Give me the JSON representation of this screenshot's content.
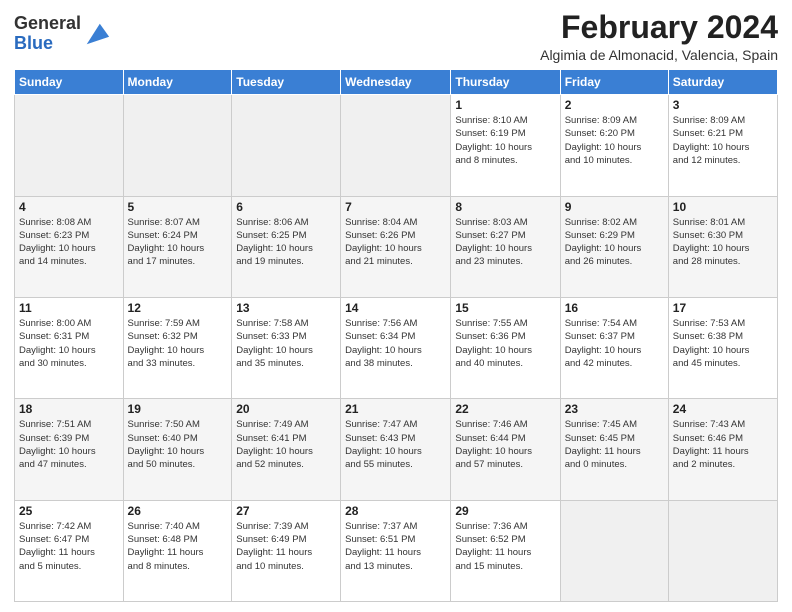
{
  "header": {
    "monthYear": "February 2024",
    "location": "Algimia de Almonacid, Valencia, Spain"
  },
  "columns": [
    "Sunday",
    "Monday",
    "Tuesday",
    "Wednesday",
    "Thursday",
    "Friday",
    "Saturday"
  ],
  "weeks": [
    [
      {
        "day": "",
        "info": ""
      },
      {
        "day": "",
        "info": ""
      },
      {
        "day": "",
        "info": ""
      },
      {
        "day": "",
        "info": ""
      },
      {
        "day": "1",
        "info": "Sunrise: 8:10 AM\nSunset: 6:19 PM\nDaylight: 10 hours\nand 8 minutes."
      },
      {
        "day": "2",
        "info": "Sunrise: 8:09 AM\nSunset: 6:20 PM\nDaylight: 10 hours\nand 10 minutes."
      },
      {
        "day": "3",
        "info": "Sunrise: 8:09 AM\nSunset: 6:21 PM\nDaylight: 10 hours\nand 12 minutes."
      }
    ],
    [
      {
        "day": "4",
        "info": "Sunrise: 8:08 AM\nSunset: 6:23 PM\nDaylight: 10 hours\nand 14 minutes."
      },
      {
        "day": "5",
        "info": "Sunrise: 8:07 AM\nSunset: 6:24 PM\nDaylight: 10 hours\nand 17 minutes."
      },
      {
        "day": "6",
        "info": "Sunrise: 8:06 AM\nSunset: 6:25 PM\nDaylight: 10 hours\nand 19 minutes."
      },
      {
        "day": "7",
        "info": "Sunrise: 8:04 AM\nSunset: 6:26 PM\nDaylight: 10 hours\nand 21 minutes."
      },
      {
        "day": "8",
        "info": "Sunrise: 8:03 AM\nSunset: 6:27 PM\nDaylight: 10 hours\nand 23 minutes."
      },
      {
        "day": "9",
        "info": "Sunrise: 8:02 AM\nSunset: 6:29 PM\nDaylight: 10 hours\nand 26 minutes."
      },
      {
        "day": "10",
        "info": "Sunrise: 8:01 AM\nSunset: 6:30 PM\nDaylight: 10 hours\nand 28 minutes."
      }
    ],
    [
      {
        "day": "11",
        "info": "Sunrise: 8:00 AM\nSunset: 6:31 PM\nDaylight: 10 hours\nand 30 minutes."
      },
      {
        "day": "12",
        "info": "Sunrise: 7:59 AM\nSunset: 6:32 PM\nDaylight: 10 hours\nand 33 minutes."
      },
      {
        "day": "13",
        "info": "Sunrise: 7:58 AM\nSunset: 6:33 PM\nDaylight: 10 hours\nand 35 minutes."
      },
      {
        "day": "14",
        "info": "Sunrise: 7:56 AM\nSunset: 6:34 PM\nDaylight: 10 hours\nand 38 minutes."
      },
      {
        "day": "15",
        "info": "Sunrise: 7:55 AM\nSunset: 6:36 PM\nDaylight: 10 hours\nand 40 minutes."
      },
      {
        "day": "16",
        "info": "Sunrise: 7:54 AM\nSunset: 6:37 PM\nDaylight: 10 hours\nand 42 minutes."
      },
      {
        "day": "17",
        "info": "Sunrise: 7:53 AM\nSunset: 6:38 PM\nDaylight: 10 hours\nand 45 minutes."
      }
    ],
    [
      {
        "day": "18",
        "info": "Sunrise: 7:51 AM\nSunset: 6:39 PM\nDaylight: 10 hours\nand 47 minutes."
      },
      {
        "day": "19",
        "info": "Sunrise: 7:50 AM\nSunset: 6:40 PM\nDaylight: 10 hours\nand 50 minutes."
      },
      {
        "day": "20",
        "info": "Sunrise: 7:49 AM\nSunset: 6:41 PM\nDaylight: 10 hours\nand 52 minutes."
      },
      {
        "day": "21",
        "info": "Sunrise: 7:47 AM\nSunset: 6:43 PM\nDaylight: 10 hours\nand 55 minutes."
      },
      {
        "day": "22",
        "info": "Sunrise: 7:46 AM\nSunset: 6:44 PM\nDaylight: 10 hours\nand 57 minutes."
      },
      {
        "day": "23",
        "info": "Sunrise: 7:45 AM\nSunset: 6:45 PM\nDaylight: 11 hours\nand 0 minutes."
      },
      {
        "day": "24",
        "info": "Sunrise: 7:43 AM\nSunset: 6:46 PM\nDaylight: 11 hours\nand 2 minutes."
      }
    ],
    [
      {
        "day": "25",
        "info": "Sunrise: 7:42 AM\nSunset: 6:47 PM\nDaylight: 11 hours\nand 5 minutes."
      },
      {
        "day": "26",
        "info": "Sunrise: 7:40 AM\nSunset: 6:48 PM\nDaylight: 11 hours\nand 8 minutes."
      },
      {
        "day": "27",
        "info": "Sunrise: 7:39 AM\nSunset: 6:49 PM\nDaylight: 11 hours\nand 10 minutes."
      },
      {
        "day": "28",
        "info": "Sunrise: 7:37 AM\nSunset: 6:51 PM\nDaylight: 11 hours\nand 13 minutes."
      },
      {
        "day": "29",
        "info": "Sunrise: 7:36 AM\nSunset: 6:52 PM\nDaylight: 11 hours\nand 15 minutes."
      },
      {
        "day": "",
        "info": ""
      },
      {
        "day": "",
        "info": ""
      }
    ]
  ]
}
